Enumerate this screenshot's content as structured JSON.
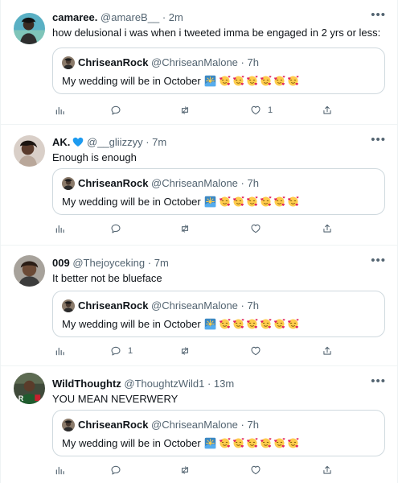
{
  "quoted": {
    "name": "ChriseanRock",
    "handle": "@ChriseanMalone",
    "sep": "·",
    "time": "7h",
    "text": "My wedding will be in October"
  },
  "tweets": [
    {
      "name": "camaree.",
      "handle": "@amareB__",
      "sep": "·",
      "time": "2m",
      "text": "how delusional i was when i tweeted imma be engaged in 2 yrs or less:",
      "likes": "1",
      "replies": ""
    },
    {
      "name": "AK.",
      "handle": "@__gliizzyy",
      "sep": "·",
      "time": "7m",
      "text": "Enough is enough",
      "likes": "",
      "replies": ""
    },
    {
      "name": "009",
      "handle": "@Thejoyceking",
      "sep": "·",
      "time": "7m",
      "text": "It better not be blueface",
      "likes": "",
      "replies": "1"
    },
    {
      "name": "WildThoughtz",
      "handle": "@ThoughtzWild1",
      "sep": "·",
      "time": "13m",
      "text": "YOU MEAN NEVERWERY",
      "likes": "",
      "replies": ""
    }
  ],
  "icons": [
    "analytics-icon",
    "reply-icon",
    "retweet-icon",
    "like-icon",
    "share-icon",
    "more-icon",
    "verified-heart-icon"
  ],
  "colors": {
    "text": "#0f1419",
    "muted": "#536471",
    "border": "#cfd9de",
    "verified_heart": "#1d9bf0"
  }
}
